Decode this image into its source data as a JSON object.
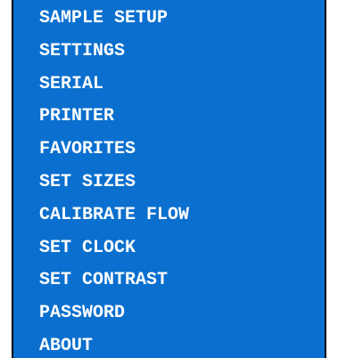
{
  "menu": {
    "items": [
      {
        "label": "SAMPLE SETUP"
      },
      {
        "label": "SETTINGS"
      },
      {
        "label": "SERIAL"
      },
      {
        "label": "PRINTER"
      },
      {
        "label": "FAVORITES"
      },
      {
        "label": "SET SIZES"
      },
      {
        "label": "CALIBRATE FLOW"
      },
      {
        "label": "SET CLOCK"
      },
      {
        "label": "SET CONTRAST"
      },
      {
        "label": "PASSWORD"
      },
      {
        "label": "ABOUT"
      }
    ]
  },
  "colors": {
    "background": "#0a6fce",
    "text": "#ffffff",
    "border": "#000000"
  }
}
